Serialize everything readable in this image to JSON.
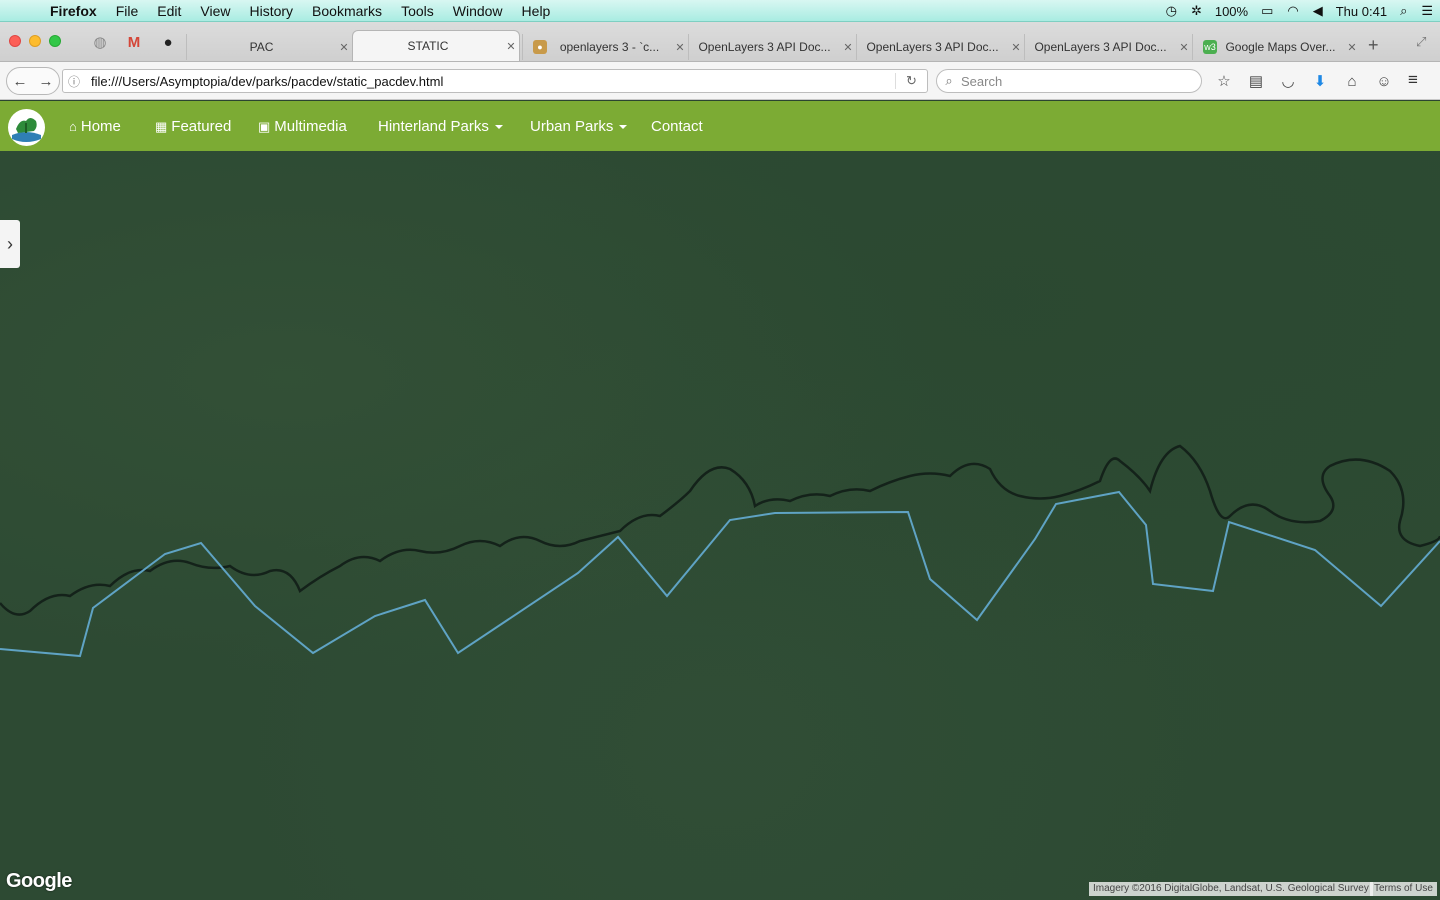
{
  "menubar": {
    "app": "Firefox",
    "items": [
      "File",
      "Edit",
      "View",
      "History",
      "Bookmarks",
      "Tools",
      "Window",
      "Help"
    ],
    "battery": "100%",
    "clock": "Thu 0:41"
  },
  "tabs": [
    {
      "label": "PAC",
      "active": false
    },
    {
      "label": "STATIC",
      "active": true
    },
    {
      "label": "openlayers 3 - `c...",
      "active": false
    },
    {
      "label": "OpenLayers 3 API Doc...",
      "active": false
    },
    {
      "label": "OpenLayers 3 API Doc...",
      "active": false
    },
    {
      "label": "OpenLayers 3 API Doc...",
      "active": false
    },
    {
      "label": "Google Maps Over...",
      "active": false
    }
  ],
  "toolbar": {
    "url": "file:///Users/Asymptopia/dev/parks/pacdev/static_pacdev.html",
    "search_placeholder": "Search"
  },
  "sitenav": {
    "home": "Home",
    "featured": "Featured",
    "multimedia": "Multimedia",
    "hinterland": "Hinterland Parks",
    "urban": "Urban Parks",
    "contact": "Contact"
  },
  "map": {
    "logo": "Google",
    "attribution": "Imagery ©2016 DigitalGlobe, Landsat, U.S. Geological Survey",
    "terms": "Terms of Use",
    "overlay_color": "#5fa3c4"
  },
  "colors": {
    "nav_green": "#7cab34",
    "map_dark_green": "#2d4a33"
  }
}
